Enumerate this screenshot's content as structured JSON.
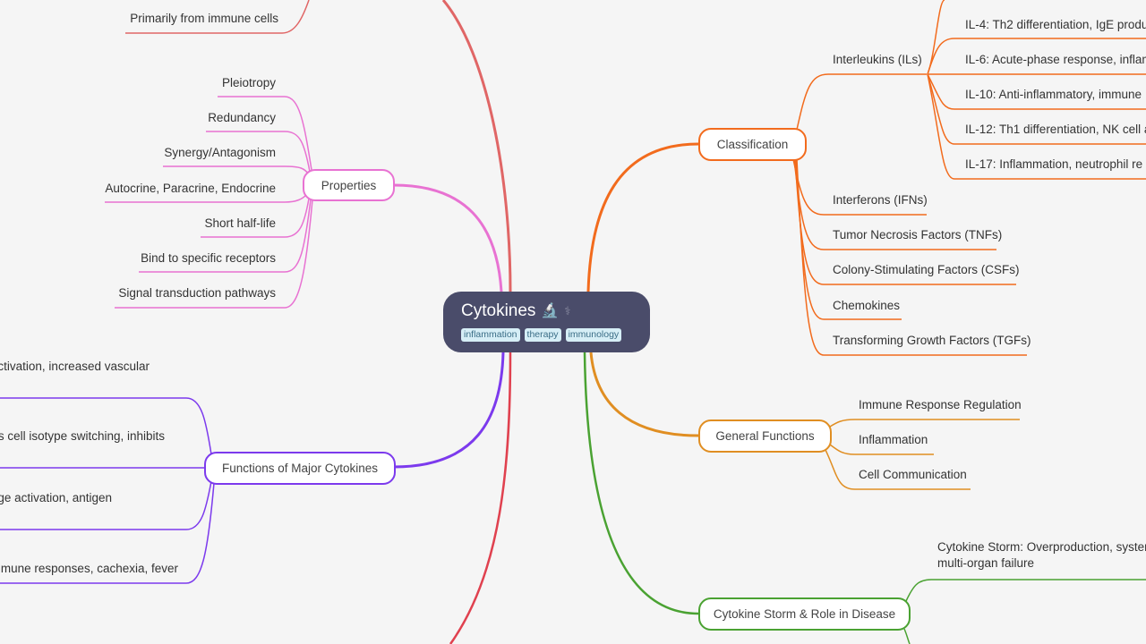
{
  "root": {
    "title": "Cytokines",
    "icons": [
      "microscope-icon",
      "medical-staff-icon"
    ],
    "icon_glyphs": [
      "🔬",
      "⚕"
    ],
    "tags": [
      "inflammation",
      "therapy",
      "immunology"
    ]
  },
  "colors": {
    "root_bg": "#4a4c6a",
    "classification": "#f26b1d",
    "general_functions": "#e08e22",
    "cytokine_storm": "#4aa232",
    "properties": "#e872d2",
    "functions_major": "#7c3aed",
    "source": "#e06666",
    "bottom_red": "#e0414f"
  },
  "branches": {
    "source": {
      "leaves": [
        "Primarily from immune cells"
      ]
    },
    "properties": {
      "label": "Properties",
      "leaves": [
        "Pleiotropy",
        "Redundancy",
        "Synergy/Antagonism",
        "Autocrine, Paracrine, Endocrine",
        "Short half-life",
        "Bind to specific receptors",
        "Signal transduction pathways"
      ]
    },
    "functions_major": {
      "label": "Functions of Major Cytokines",
      "leaves": [
        "ctivation, increased vascular",
        "s cell isotype switching, inhibits",
        "ge activation, antigen",
        "nmune responses, cachexia, fever"
      ]
    },
    "classification": {
      "label": "Classification",
      "interleukins": {
        "label": "Interleukins (ILs)",
        "leaves": [
          "IL-4: Th2 differentiation, IgE produ",
          "IL-6: Acute-phase response, inflam",
          "IL-10: Anti-inflammatory, immune",
          "IL-12: Th1 differentiation, NK cell a",
          "IL-17: Inflammation, neutrophil re"
        ]
      },
      "leaves": [
        "Interferons (IFNs)",
        "Tumor Necrosis Factors (TNFs)",
        "Colony-Stimulating Factors (CSFs)",
        "Chemokines",
        "Transforming Growth Factors (TGFs)"
      ]
    },
    "general_functions": {
      "label": "General Functions",
      "leaves": [
        "Immune Response Regulation",
        "Inflammation",
        "Cell Communication"
      ]
    },
    "cytokine_storm": {
      "label": "Cytokine Storm & Role in Disease",
      "leaves": [
        "Cytokine Storm: Overproduction, syster\nmulti-organ failure"
      ],
      "leaf_line1": "Cytokine Storm: Overproduction, syster",
      "leaf_line2": "multi-organ failure"
    }
  }
}
